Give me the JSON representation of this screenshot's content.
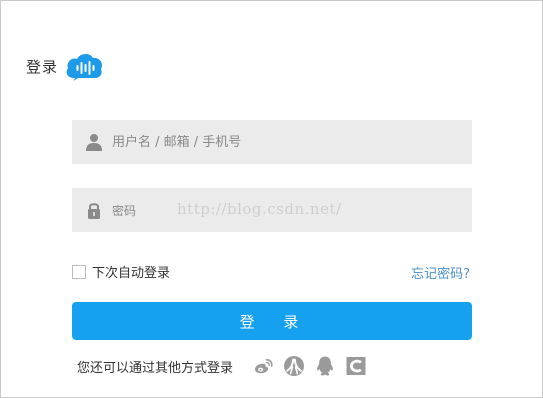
{
  "header": {
    "title": "登录",
    "logo_icon": "cloud-voice-logo",
    "logo_color": "#1e9be8"
  },
  "form": {
    "username_placeholder": "用户名 / 邮箱 / 手机号",
    "password_label": "密码",
    "password_placeholder": "",
    "watermark": "http://blog.csdn.net/",
    "remember_label": "下次自动登录",
    "forgot_label": "忘记密码?",
    "login_label": "登 录"
  },
  "other_login": {
    "text": "您还可以通过其他方式登录",
    "providers": [
      "weibo-icon",
      "renren-icon",
      "qq-icon",
      "csdn-icon"
    ]
  },
  "colors": {
    "primary": "#15a1f0",
    "link": "#4a8fc7",
    "field_bg": "#ebebeb",
    "icon_gray": "#9a9a9a"
  }
}
